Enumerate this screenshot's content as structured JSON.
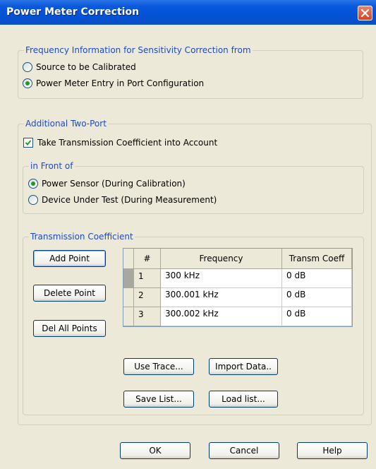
{
  "window": {
    "title": "Power Meter Correction"
  },
  "frequency_group": {
    "legend": "Frequency Information for Sensitivity Correction from",
    "options": [
      {
        "label": "Source to be Calibrated",
        "selected": false
      },
      {
        "label": "Power Meter Entry in Port Configuration",
        "selected": true
      }
    ]
  },
  "two_port_group": {
    "legend": "Additional Two-Port",
    "take_transmission": {
      "label": "Take Transmission Coefficient into Account",
      "checked": true
    },
    "in_front_of": {
      "legend": "in Front of",
      "options": [
        {
          "label": "Power Sensor (During Calibration)",
          "selected": true
        },
        {
          "label": "Device Under Test (During Measurement)",
          "selected": false
        }
      ]
    }
  },
  "transmission_group": {
    "legend": "Transmission Coefficient",
    "buttons": {
      "add_point": "Add Point",
      "delete_point": "Delete Point",
      "del_all_points": "Del All Points",
      "use_trace": "Use Trace...",
      "import_data": "Import Data..",
      "save_list": "Save List...",
      "load_list": "Load list..."
    },
    "table": {
      "headers": [
        "#",
        "Frequency",
        "Transm Coeff"
      ],
      "rows": [
        [
          "1",
          "300 kHz",
          "0 dB"
        ],
        [
          "2",
          "300.001 kHz",
          "0 dB"
        ],
        [
          "3",
          "300.002 kHz",
          "0 dB"
        ]
      ]
    }
  },
  "dialog_buttons": {
    "ok": "OK",
    "cancel": "Cancel",
    "help": "Help"
  },
  "colors": {
    "title_bar": "#0352d6",
    "dialog_background": "#ece9d8",
    "group_legend": "#1f48c8",
    "close_button": "#d5431f",
    "radio_selected": "#1f9a2a",
    "checkmark": "#21a121"
  }
}
